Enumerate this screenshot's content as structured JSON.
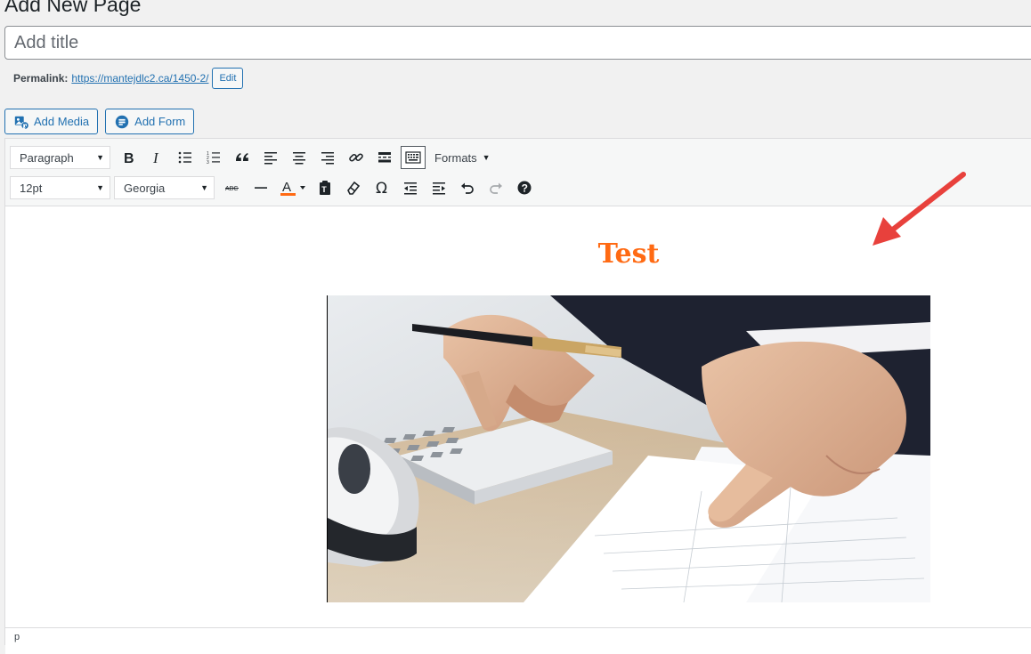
{
  "page": {
    "heading": "Add New Page"
  },
  "title_field": {
    "placeholder": "Add title",
    "value": ""
  },
  "permalink": {
    "label": "Permalink:",
    "url": "https://mantejdlc2.ca/1450-2/",
    "edit_label": "Edit"
  },
  "media_buttons": {
    "add_media": "Add Media",
    "add_form": "Add Form"
  },
  "toolbar": {
    "block_format": "Paragraph",
    "font_size": "12pt",
    "font_family": "Georgia",
    "formats_label": "Formats",
    "text_color": "#ff6a13"
  },
  "content": {
    "title": "Test",
    "title_color": "#ff6a13"
  },
  "statusbar": {
    "path": "p"
  },
  "colors": {
    "accent": "#2271b1",
    "annotation_arrow": "#e8413c"
  }
}
